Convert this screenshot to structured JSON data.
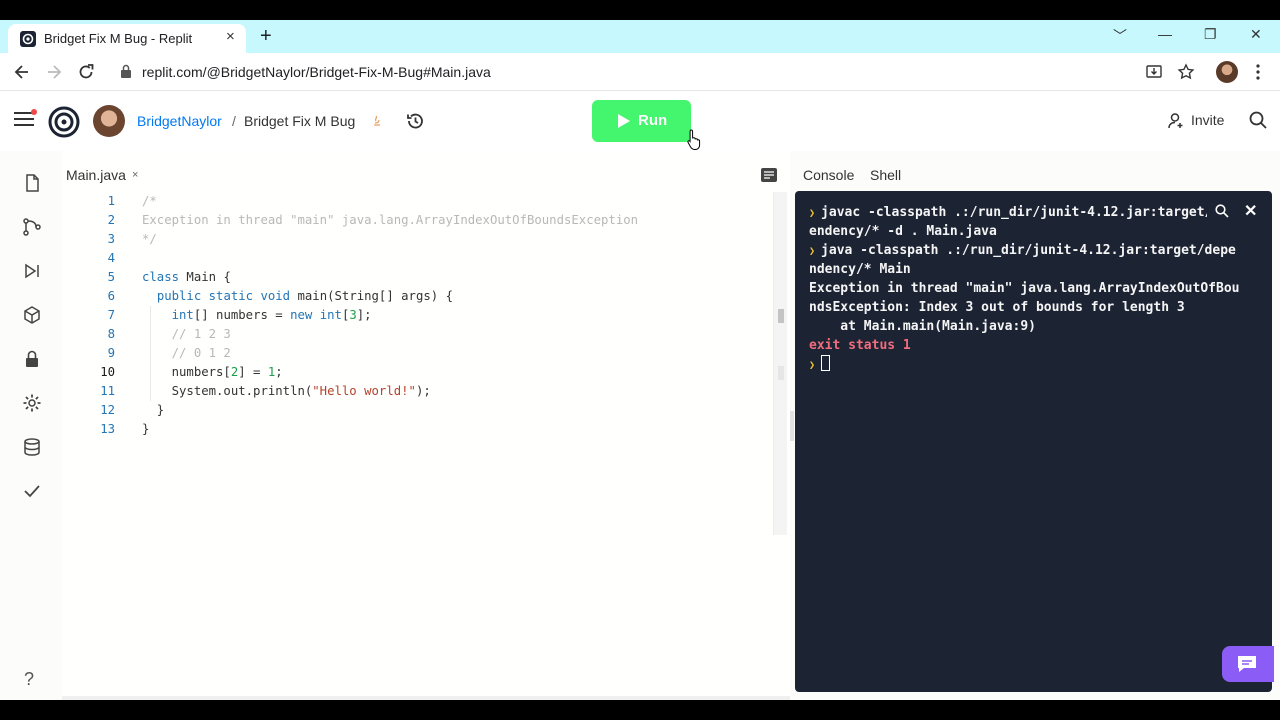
{
  "browser": {
    "tab_title": "Bridget Fix M Bug - Replit",
    "tab_close": "×",
    "new_tab": "+",
    "url": "replit.com/@BridgetNaylor/Bridget-Fix-M-Bug#Main.java",
    "window_controls": [
      "﹀",
      "—",
      "❐",
      "✕"
    ]
  },
  "header": {
    "owner": "BridgetNaylor",
    "separator": "/",
    "repl_name": "Bridget Fix M Bug",
    "run_label": "Run",
    "invite_label": "Invite",
    "accent_color": "#44f56e"
  },
  "sidebar": {
    "items": [
      "file-icon",
      "version-control-icon",
      "debugger-icon",
      "packages-icon",
      "secrets-icon",
      "settings-icon",
      "database-icon",
      "unit-tests-icon"
    ],
    "help_label": "?"
  },
  "editor": {
    "file_tab": "Main.java",
    "file_tab_close": "×",
    "active_line": 10,
    "lines": [
      {
        "n": "1",
        "text": "/*"
      },
      {
        "n": "2",
        "text": "Exception in thread \"main\" java.lang.ArrayIndexOutOfBoundsException"
      },
      {
        "n": "3",
        "text": "*/"
      },
      {
        "n": "4",
        "text": ""
      },
      {
        "n": "5",
        "text": "class Main {"
      },
      {
        "n": "6",
        "text": "  public static void main(String[] args) {"
      },
      {
        "n": "7",
        "text": "    int[] numbers = new int[3];"
      },
      {
        "n": "8",
        "text": "    // 1 2 3"
      },
      {
        "n": "9",
        "text": "    // 0 1 2"
      },
      {
        "n": "10",
        "text": "    numbers[2] = 1;"
      },
      {
        "n": "11",
        "text": "    System.out.println(\"Hello world!\");"
      },
      {
        "n": "12",
        "text": "  }"
      },
      {
        "n": "13",
        "text": "}"
      }
    ]
  },
  "console": {
    "tabs": [
      "Console",
      "Shell"
    ],
    "close": "✕",
    "lines": [
      {
        "prompt": true,
        "text": "javac -classpath .:/run_dir/junit-4.12.jar:target/dep"
      },
      {
        "prompt": false,
        "text": "endency/* -d . Main.java"
      },
      {
        "prompt": true,
        "text": "java -classpath .:/run_dir/junit-4.12.jar:target/depe"
      },
      {
        "prompt": false,
        "text": "ndency/* Main"
      },
      {
        "prompt": false,
        "text": "Exception in thread \"main\" java.lang.ArrayIndexOutOfBou"
      },
      {
        "prompt": false,
        "text": "ndsException: Index 3 out of bounds for length 3"
      },
      {
        "prompt": false,
        "text": "    at Main.main(Main.java:9)"
      },
      {
        "prompt": false,
        "error": true,
        "text": "exit status 1"
      }
    ],
    "terminal_bg": "#1c2333",
    "error_color": "#f26d7d"
  }
}
